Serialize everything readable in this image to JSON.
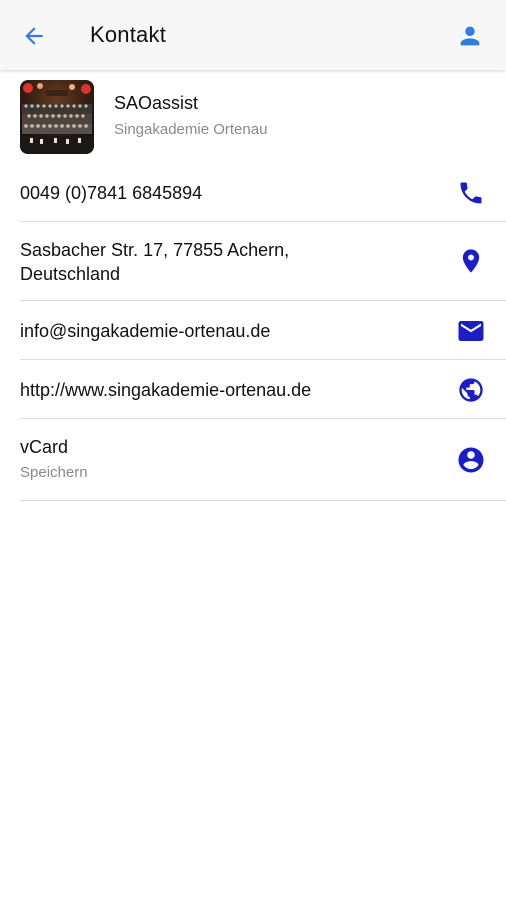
{
  "header": {
    "title": "Kontakt",
    "back_icon": "arrow-left-icon",
    "profile_icon": "person-icon"
  },
  "organization": {
    "name": "SAOassist",
    "subtitle": "Singakademie Ortenau"
  },
  "contacts": {
    "phone": {
      "value": "0049 (0)7841 6845894",
      "icon": "phone-icon"
    },
    "address": {
      "line1": "Sasbacher Str. 17, 77855 Achern,",
      "line2": "Deutschland",
      "icon": "location-pin-icon"
    },
    "email": {
      "value": "info@singakademie-ortenau.de",
      "icon": "envelope-icon"
    },
    "website": {
      "value": "http://www.singakademie-ortenau.de",
      "icon": "globe-icon"
    },
    "vcard": {
      "label": "vCard",
      "sub": "Speichern",
      "icon": "account-circle-icon"
    }
  },
  "colors": {
    "header_accent": "#2f7de1",
    "icon_blue": "#1b1ec8",
    "text": "#111111",
    "subtext": "#8a8a8a"
  }
}
